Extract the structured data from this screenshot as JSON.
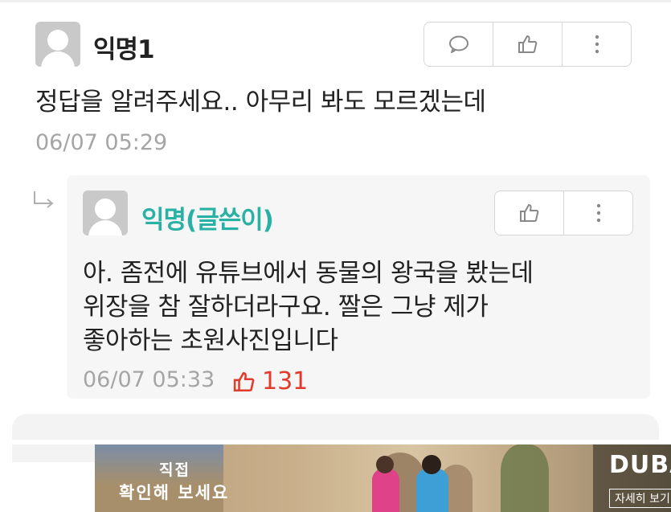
{
  "comment": {
    "author": "익명1",
    "text": "정답을 알려주세요.. 아무리 봐도 모르겠는데",
    "timestamp": "06/07 05:29",
    "author_color": "#222222"
  },
  "reply": {
    "author": "익명(글쓴이)",
    "author_color": "#2ab1a6",
    "lines": [
      "아. 좀전에 유튜브에서 동물의 왕국을 봤는데",
      "위장을 참 잘하더라구요. 짤은 그냥 제가",
      "좋아하는 초원사진입니다"
    ],
    "timestamp": "06/07 05:33",
    "like_count": "131",
    "like_color": "#e23b2e"
  },
  "icons": {
    "comment": "speech-bubble-icon",
    "like": "thumbs-up-icon",
    "more": "more-vertical-icon",
    "reply_arrow": "reply-arrow-icon"
  },
  "ad": {
    "line1": "직접",
    "line2": "확인해 보세요",
    "logo": "DUBA",
    "cta": "자세히 보기"
  }
}
